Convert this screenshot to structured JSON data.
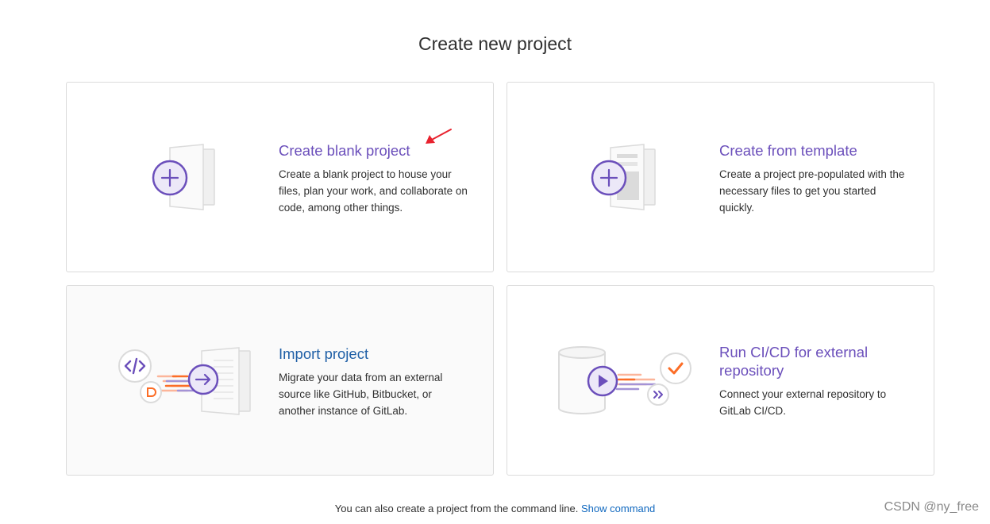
{
  "page": {
    "title": "Create new project"
  },
  "cards": [
    {
      "title": "Create blank project",
      "description": "Create a blank project to house your files, plan your work, and collaborate on code, among other things.",
      "icon": "blank-project-illustration"
    },
    {
      "title": "Create from template",
      "description": "Create a project pre-populated with the necessary files to get you started quickly.",
      "icon": "template-project-illustration"
    },
    {
      "title": "Import project",
      "description": "Migrate your data from an external source like GitHub, Bitbucket, or another instance of GitLab.",
      "icon": "import-project-illustration"
    },
    {
      "title": "Run CI/CD for external repository",
      "description": "Connect your external repository to GitLab CI/CD.",
      "icon": "cicd-project-illustration"
    }
  ],
  "footer": {
    "text": "You can also create a project from the command line.",
    "link": "Show command"
  },
  "watermark": "CSDN @ny_free",
  "colors": {
    "purple": "#6b4fbb",
    "blue_title": "#1f5fa6",
    "link": "#1068bf",
    "orange": "#fc6d26",
    "arrow_red": "#e8222e"
  }
}
